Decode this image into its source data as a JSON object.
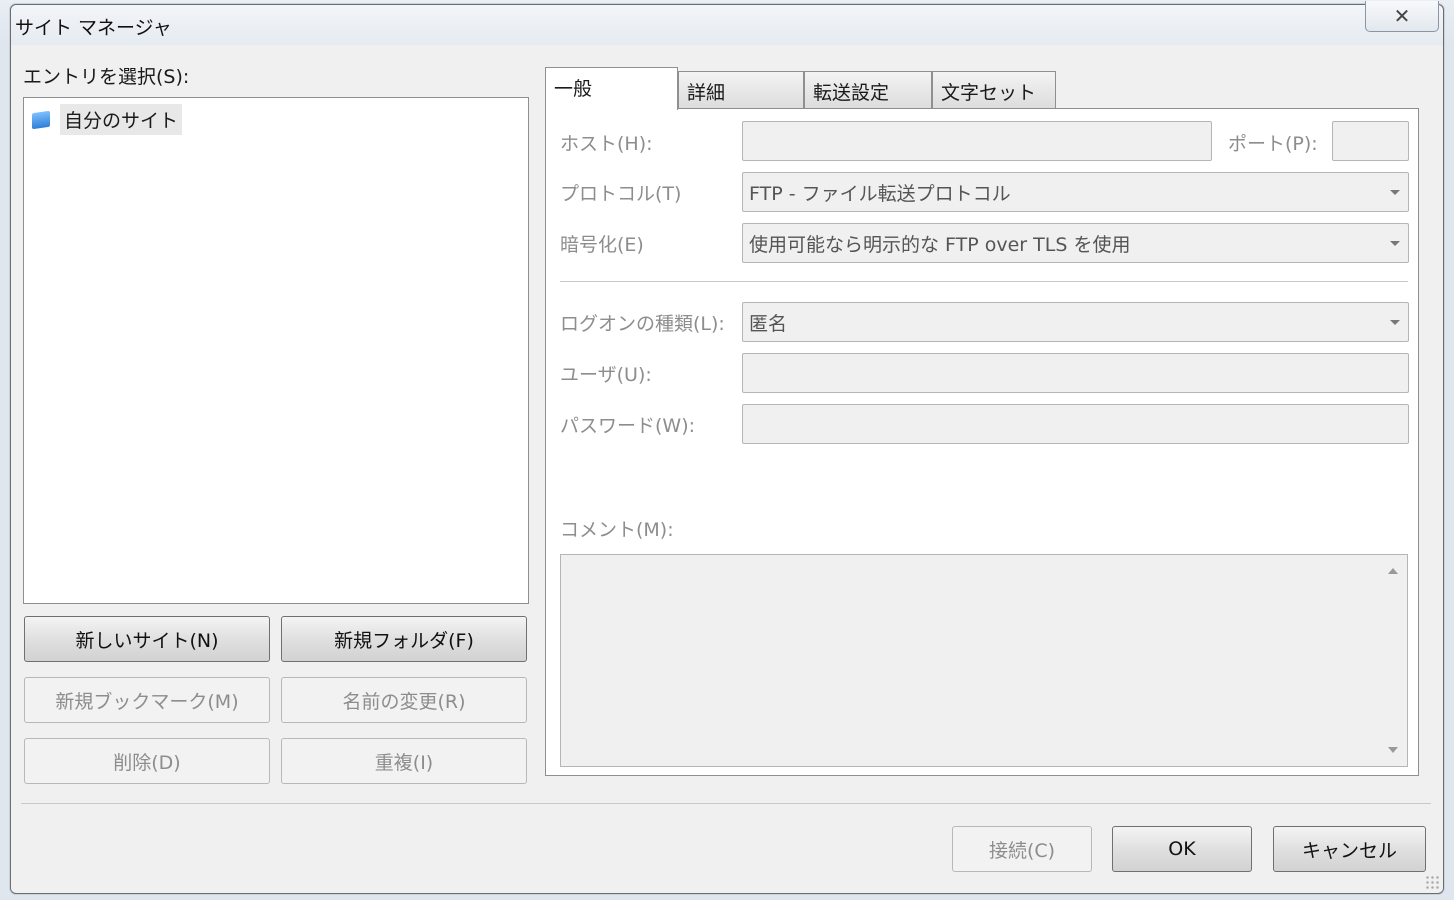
{
  "window": {
    "title": "サイト マネージャ",
    "close_glyph": "✕"
  },
  "left": {
    "select_label": "エントリを選択(S):",
    "tree": [
      {
        "label": "自分のサイト",
        "icon": "folder-icon"
      }
    ],
    "buttons": {
      "new_site": "新しいサイト(N)",
      "new_folder": "新規フォルダ(F)",
      "new_bookmark": "新規ブックマーク(M)",
      "rename": "名前の変更(R)",
      "delete": "削除(D)",
      "duplicate": "重複(I)"
    }
  },
  "tabs": [
    "一般",
    "詳細",
    "転送設定",
    "文字セット"
  ],
  "general": {
    "host_label": "ホスト(H):",
    "host_value": "",
    "port_label": "ポート(P):",
    "port_value": "",
    "protocol_label": "プロトコル(T)",
    "protocol_value": "FTP - ファイル転送プロトコル",
    "encryption_label": "暗号化(E)",
    "encryption_value": "使用可能なら明示的な FTP over TLS を使用",
    "logon_label": "ログオンの種類(L):",
    "logon_value": "匿名",
    "user_label": "ユーザ(U):",
    "user_value": "",
    "password_label": "パスワード(W):",
    "password_value": "",
    "comment_label": "コメント(M):",
    "comment_value": ""
  },
  "footer": {
    "connect": "接続(C)",
    "ok": "OK",
    "cancel": "キャンセル"
  }
}
